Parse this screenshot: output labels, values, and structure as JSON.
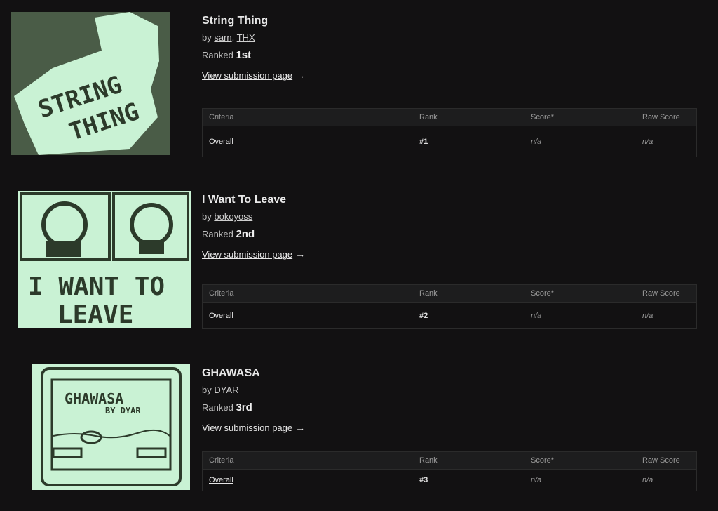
{
  "columns": {
    "criteria": "Criteria",
    "rank": "Rank",
    "score": "Score*",
    "raw": "Raw Score"
  },
  "by_prefix": "by",
  "ranked_prefix": "Ranked",
  "view_label": "View submission page",
  "arrow": "→",
  "entries": [
    {
      "title": "String Thing",
      "authors": [
        "sarn",
        "THX"
      ],
      "ranked": "1st",
      "thumb_text": [
        "STRING",
        "THING"
      ],
      "row": {
        "criteria": "Overall",
        "rank": "#1",
        "score": "n/a",
        "raw": "n/a"
      }
    },
    {
      "title": "I Want To Leave",
      "authors": [
        "bokoyoss"
      ],
      "ranked": "2nd",
      "thumb_text": [
        "I WANT TO",
        "LEAVE"
      ],
      "row": {
        "criteria": "Overall",
        "rank": "#2",
        "score": "n/a",
        "raw": "n/a"
      }
    },
    {
      "title": "GHAWASA",
      "authors": [
        "DYAR"
      ],
      "ranked": "3rd",
      "thumb_text": [
        "GHAWASA",
        "BY DYAR"
      ],
      "row": {
        "criteria": "Overall",
        "rank": "#3",
        "score": "n/a",
        "raw": "n/a"
      }
    }
  ],
  "colors": {
    "bg": "#121112",
    "thumb_light": "#c9f2d4",
    "thumb_dark": "#4a5c47"
  }
}
